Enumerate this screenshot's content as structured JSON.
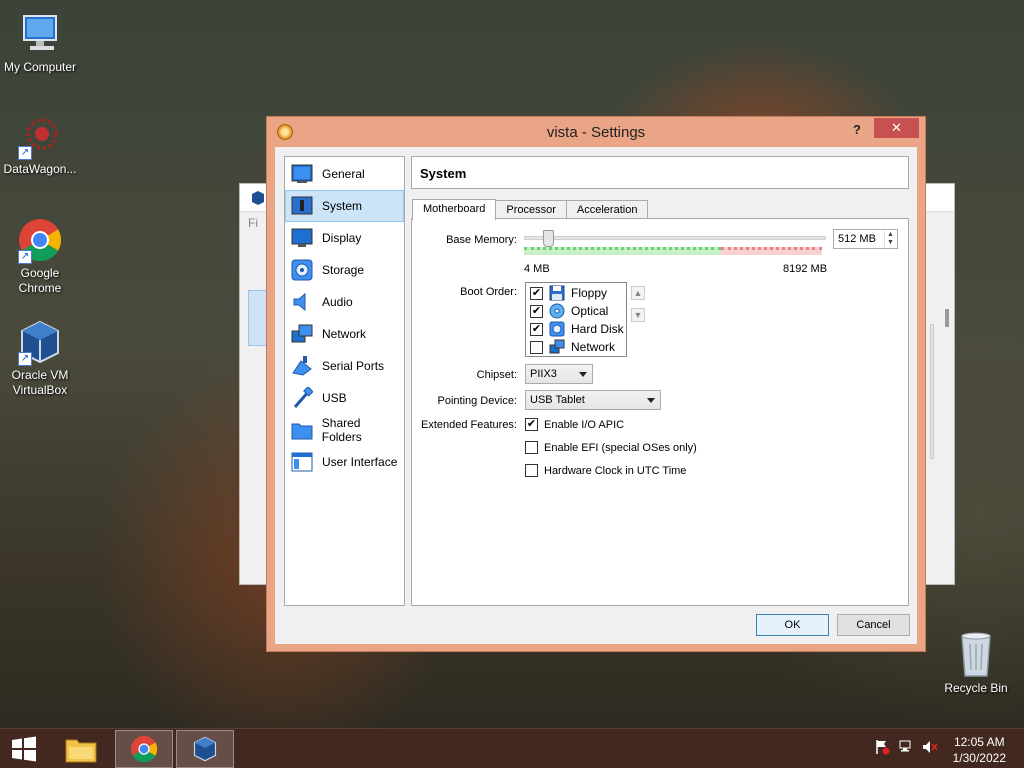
{
  "desktop": {
    "icons": [
      {
        "label": "My Computer",
        "icon": "computer-icon"
      },
      {
        "label": "DataWagon...",
        "icon": "datawagon-icon"
      },
      {
        "label": "Google Chrome",
        "icon": "chrome-icon"
      },
      {
        "label": "Oracle VM VirtualBox",
        "icon": "virtualbox-icon"
      }
    ],
    "recycle_bin": "Recycle Bin"
  },
  "background_window": {
    "menu_fragment": "Fi"
  },
  "dialog": {
    "title": "vista - Settings",
    "help_label": "?",
    "close_label": "✕",
    "categories": [
      {
        "label": "General",
        "icon": "general-icon"
      },
      {
        "label": "System",
        "icon": "system-icon",
        "selected": true
      },
      {
        "label": "Display",
        "icon": "display-icon"
      },
      {
        "label": "Storage",
        "icon": "storage-icon"
      },
      {
        "label": "Audio",
        "icon": "audio-icon"
      },
      {
        "label": "Network",
        "icon": "network-icon"
      },
      {
        "label": "Serial Ports",
        "icon": "serial-ports-icon"
      },
      {
        "label": "USB",
        "icon": "usb-icon"
      },
      {
        "label": "Shared Folders",
        "icon": "shared-folders-icon"
      },
      {
        "label": "User Interface",
        "icon": "user-interface-icon"
      }
    ],
    "page_title": "System",
    "tabs": [
      "Motherboard",
      "Processor",
      "Acceleration"
    ],
    "active_tab": "Motherboard",
    "motherboard": {
      "base_memory_label": "Base Memory:",
      "base_memory_value": "512 MB",
      "memory_min": "4 MB",
      "memory_max": "8192 MB",
      "memory_fraction": 0.062,
      "boot_order_label": "Boot Order:",
      "boot_items": [
        {
          "label": "Floppy",
          "checked": true,
          "icon": "floppy-icon"
        },
        {
          "label": "Optical",
          "checked": true,
          "icon": "optical-icon"
        },
        {
          "label": "Hard Disk",
          "checked": true,
          "icon": "hard-disk-icon"
        },
        {
          "label": "Network",
          "checked": false,
          "icon": "network-boot-icon"
        }
      ],
      "move_up": "▲",
      "move_down": "▼",
      "chipset_label": "Chipset:",
      "chipset_value": "PIIX3",
      "pointing_label": "Pointing Device:",
      "pointing_value": "USB Tablet",
      "extended_label": "Extended Features:",
      "features": [
        {
          "label": "Enable I/O APIC",
          "checked": true
        },
        {
          "label": "Enable EFI (special OSes only)",
          "checked": false
        },
        {
          "label": "Hardware Clock in UTC Time",
          "checked": false
        }
      ]
    },
    "ok_label": "OK",
    "cancel_label": "Cancel"
  },
  "taskbar": {
    "time": "12:05 AM",
    "date": "1/30/2022",
    "colors": {
      "accent": "#e9a585",
      "selection": "#cce4f7"
    }
  }
}
